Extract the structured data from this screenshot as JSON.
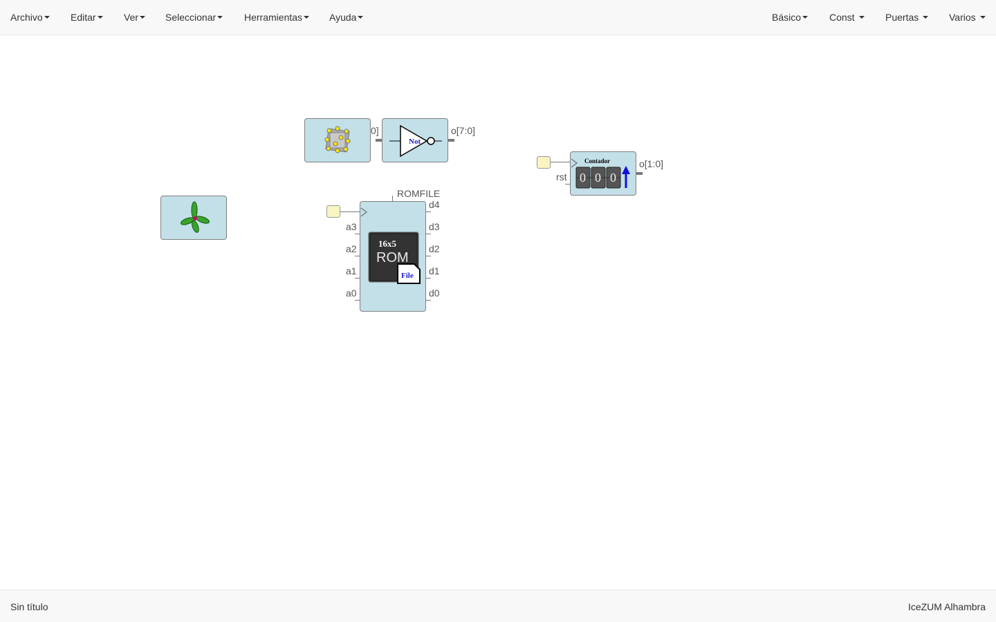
{
  "menu_left": [
    {
      "label": "Archivo"
    },
    {
      "label": "Editar"
    },
    {
      "label": "Ver"
    },
    {
      "label": "Seleccionar"
    },
    {
      "label": "Herramientas"
    },
    {
      "label": "Ayuda"
    }
  ],
  "menu_right": [
    {
      "label": "Básico"
    },
    {
      "label": "Const"
    },
    {
      "label": "Puertas"
    },
    {
      "label": "Varios"
    }
  ],
  "canvas": {
    "not_block": {
      "label": "Not",
      "out_label": "o[7:0]",
      "in_label": "0]"
    },
    "counter_block": {
      "title": "Contador",
      "rst_label": "rst",
      "out_label": "o[1:0]",
      "digits": [
        "0",
        "0",
        "0"
      ]
    },
    "rom_block": {
      "param_label": "ROMFILE",
      "chip_size": "16x5",
      "chip_text": "ROM",
      "file_text": "File",
      "inputs": [
        "a3",
        "a2",
        "a1",
        "a0"
      ],
      "outputs": [
        "d4",
        "d3",
        "d2",
        "d1",
        "d0"
      ]
    }
  },
  "footer": {
    "filename": "Sin título",
    "board": "IceZUM Alhambra"
  }
}
